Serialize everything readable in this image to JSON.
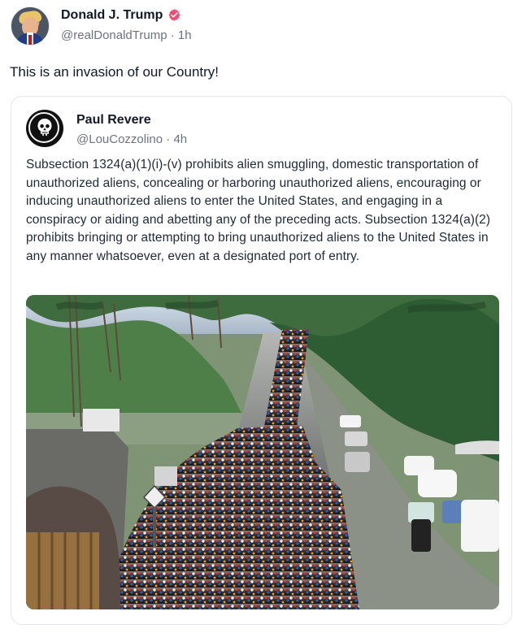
{
  "post": {
    "author": {
      "display_name": "Donald J. Trump",
      "handle": "@realDonaldTrump",
      "separator": " · ",
      "time": "1h",
      "verified_icon": "verified-badge-icon",
      "accent": "#ef4c74"
    },
    "text": "This is an invasion of our Country!",
    "quoted_post": {
      "author": {
        "display_name": "Paul Revere",
        "handle": "@LouCozzolino",
        "separator": " · ",
        "time": "4h",
        "avatar_icon": "skull-logo-icon"
      },
      "text": "Subsection 1324(a)(1)(i)-(v) prohibits alien smuggling, domestic transportation of unauthorized aliens, concealing or harboring unauthorized aliens, encouraging or inducing unauthorized aliens to enter the United States, and engaging in a conspiracy or aiding and abetting any of the preceding acts. Subsection 1324(a)(2) prohibits bringing or attempting to bring unauthorized aliens to the United States in any manner whatsoever, even at a designated port of entry.",
      "image": {
        "subject": "caravan-road-photo"
      }
    }
  }
}
